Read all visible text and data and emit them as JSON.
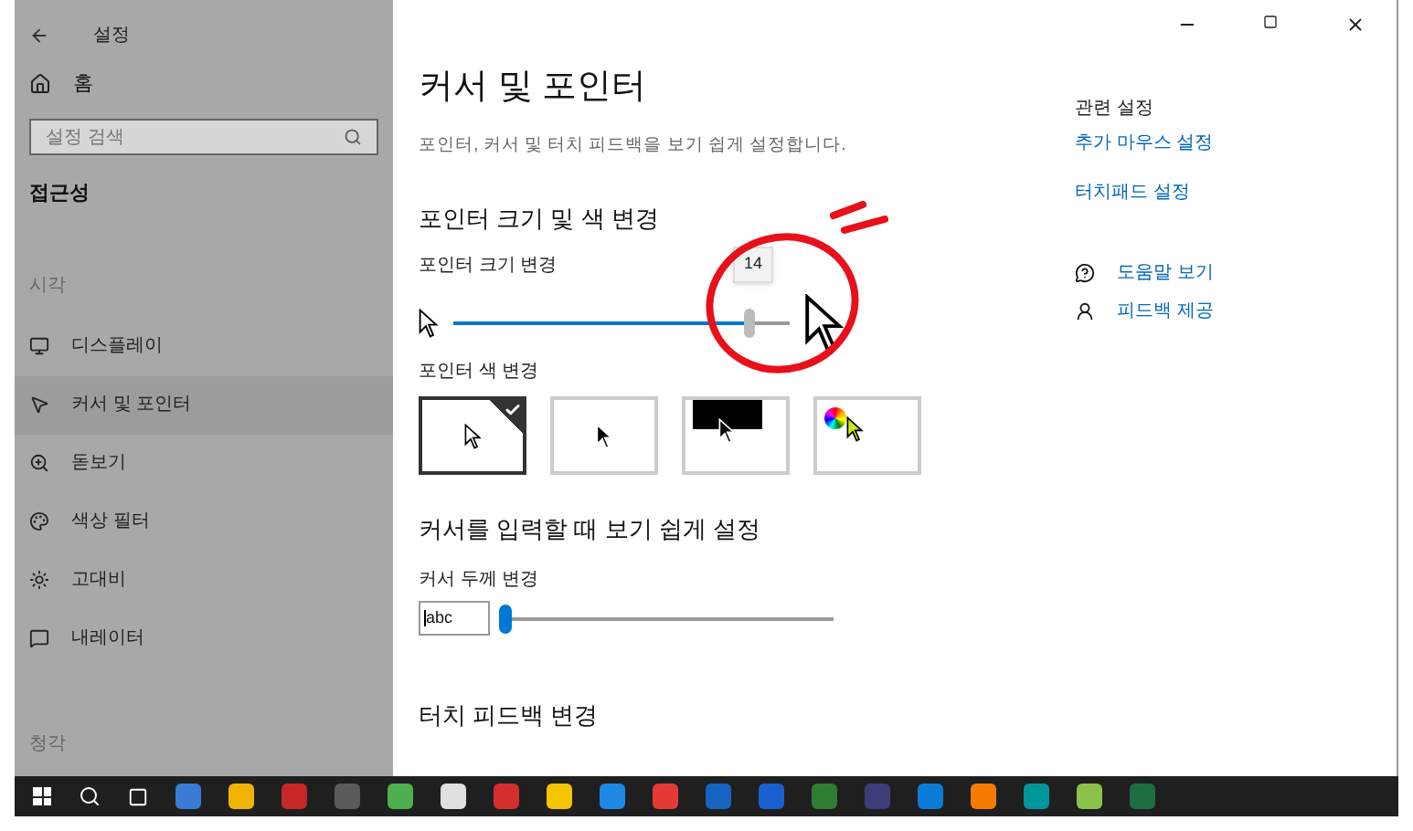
{
  "window": {
    "title": "설정"
  },
  "sidebar": {
    "home": "홈",
    "search": {
      "placeholder": "설정 검색"
    },
    "section": "접근성",
    "groups": [
      {
        "label": "시각",
        "items": [
          {
            "kind": "display",
            "label": "디스플레이",
            "selected": false
          },
          {
            "kind": "cursor",
            "label": "커서 및 포인터",
            "selected": true
          },
          {
            "kind": "magnifier",
            "label": "돋보기",
            "selected": false
          },
          {
            "kind": "color",
            "label": "색상 필터",
            "selected": false
          },
          {
            "kind": "contrast",
            "label": "고대비",
            "selected": false
          },
          {
            "kind": "narrator",
            "label": "내레이터",
            "selected": false
          }
        ]
      },
      {
        "label": "청각"
      }
    ]
  },
  "page": {
    "title": "커서 및 포인터",
    "description": "포인터, 커서 및 터치 피드백을 보기 쉽게 설정합니다.",
    "pointer_section": {
      "title": "포인터 크기 및 색 변경",
      "size_label": "포인터 크기 변경",
      "size_slider": {
        "level": 0.88,
        "tooltip": "14"
      },
      "color_label": "포인터 색 변경",
      "color_options": [
        {
          "kind": "white",
          "selected": true
        },
        {
          "kind": "black",
          "selected": false
        },
        {
          "kind": "inverted",
          "selected": false
        },
        {
          "kind": "custom",
          "selected": false
        }
      ]
    },
    "cursor_section": {
      "title": "커서를 입력할 때 보기 쉽게 설정",
      "thickness_label": "커서 두께 변경",
      "preview": "abc",
      "thickness_slider": {
        "level": 0
      }
    },
    "touch_section": {
      "title": "터치 피드백 변경"
    }
  },
  "related": {
    "title": "관련 설정",
    "links": [
      "추가 마우스 설정",
      "터치패드 설정"
    ],
    "help": [
      {
        "kind": "help",
        "label": "도움말 보기"
      },
      {
        "kind": "feedback",
        "label": "피드백 제공"
      }
    ]
  }
}
